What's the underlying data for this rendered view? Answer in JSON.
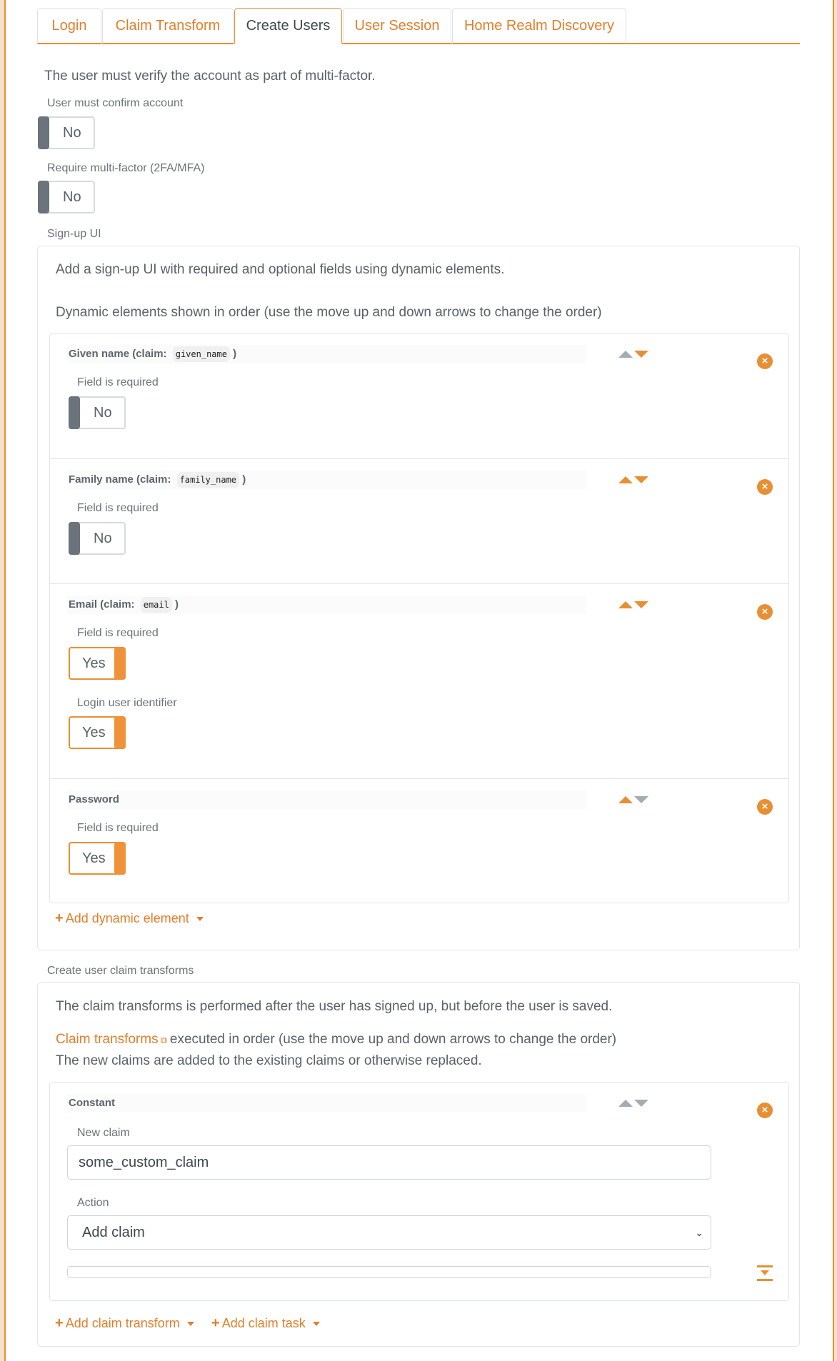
{
  "tabs": [
    {
      "label": "Login",
      "active": false
    },
    {
      "label": "Claim Transform",
      "active": false
    },
    {
      "label": "Create Users",
      "active": true
    },
    {
      "label": "User Session",
      "active": false
    },
    {
      "label": "Home Realm Discovery",
      "active": false
    }
  ],
  "intro": "The user must verify the account as part of multi-factor.",
  "confirm_account": {
    "label": "User must confirm account",
    "value": "No",
    "enabled": false
  },
  "require_mfa": {
    "label": "Require multi-factor (2FA/MFA)",
    "value": "No",
    "enabled": false
  },
  "signup": {
    "section_label": "Sign-up UI",
    "description": "Add a sign-up UI with required and optional fields using dynamic elements.",
    "order_hint": "Dynamic elements shown in order (use the move up and down arrows to change the order)",
    "elements": [
      {
        "title": "Given name (claim:",
        "claim": "given_name",
        "close": ")",
        "fields": [
          {
            "label": "Field is required",
            "value": "No"
          }
        ]
      },
      {
        "title": "Family name (claim:",
        "claim": "family_name",
        "close": ")",
        "fields": [
          {
            "label": "Field is required",
            "value": "No"
          }
        ]
      },
      {
        "title": "Email (claim:",
        "claim": "email",
        "close": ")",
        "fields": [
          {
            "label": "Field is required",
            "value": "Yes"
          },
          {
            "label": "Login user identifier",
            "value": "Yes"
          }
        ]
      },
      {
        "title": "Password",
        "fields": [
          {
            "label": "Field is required",
            "value": "Yes"
          }
        ]
      }
    ],
    "add_element_label": "Add dynamic element"
  },
  "claim_transforms": {
    "section_label": "Create user claim transforms",
    "description": "The claim transforms is performed after the user has signed up, but before the user is saved.",
    "link_label": "Claim transforms",
    "order_hint": "executed in order (use the move up and down arrows to change the order)",
    "replace_hint": "The new claims are added to the existing claims or otherwise replaced.",
    "items": [
      {
        "title": "Constant",
        "new_claim_label": "New claim",
        "new_claim_value": "some_custom_claim",
        "action_label": "Action",
        "action_value": "Add claim",
        "extra_value": ""
      }
    ],
    "add_transform_label": "Add claim transform",
    "add_task_label": "Add claim task"
  },
  "icons": {
    "remove": "×",
    "plus": "+",
    "external_link": "⧉",
    "select_chevron": "⌄"
  },
  "colors": {
    "accent": "#e88f34",
    "muted": "#6b737c",
    "text": "#5a6169"
  }
}
